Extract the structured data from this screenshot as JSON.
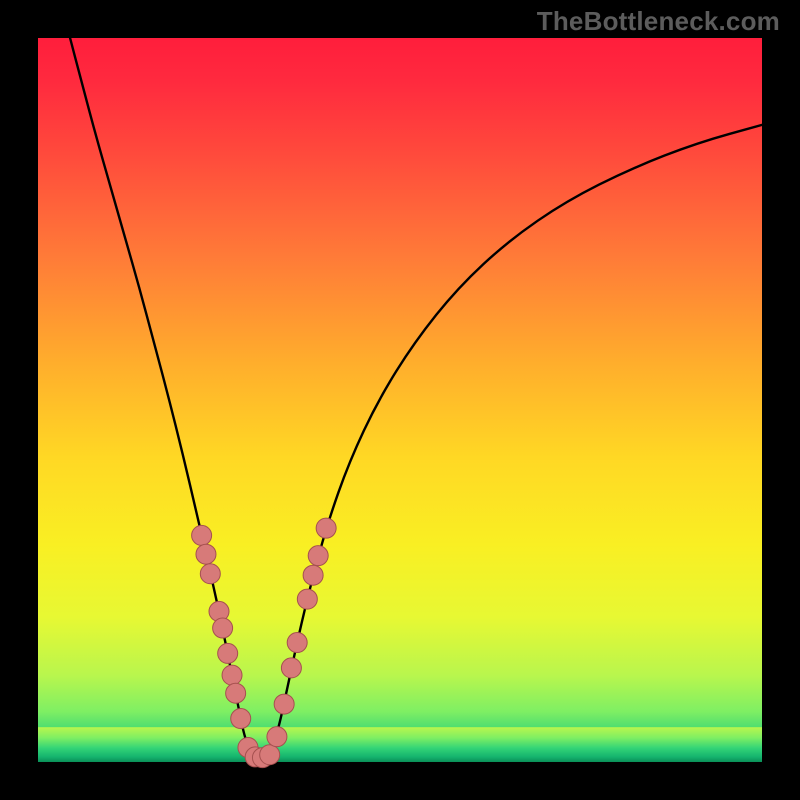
{
  "watermark": "TheBottleneck.com",
  "colors": {
    "frame": "#000000",
    "curve": "#000000",
    "dot_fill": "#d77a79",
    "dot_stroke": "#a5504f",
    "gradient_stops": [
      {
        "offset": 0.0,
        "color": "#ff1e3c"
      },
      {
        "offset": 0.06,
        "color": "#ff2a3e"
      },
      {
        "offset": 0.16,
        "color": "#ff4a3c"
      },
      {
        "offset": 0.3,
        "color": "#ff7a38"
      },
      {
        "offset": 0.45,
        "color": "#ffae2c"
      },
      {
        "offset": 0.58,
        "color": "#ffd824"
      },
      {
        "offset": 0.7,
        "color": "#f9ef23"
      },
      {
        "offset": 0.8,
        "color": "#e7f833"
      },
      {
        "offset": 0.88,
        "color": "#b9f64d"
      },
      {
        "offset": 0.93,
        "color": "#7fef63"
      },
      {
        "offset": 0.965,
        "color": "#33d477"
      },
      {
        "offset": 0.985,
        "color": "#15b46e"
      },
      {
        "offset": 1.0,
        "color": "#0a8f58"
      }
    ],
    "green_band": {
      "top": 0.952,
      "stops": [
        {
          "offset": 0.0,
          "color": "#b9f64d"
        },
        {
          "offset": 0.3,
          "color": "#7fef63"
        },
        {
          "offset": 0.6,
          "color": "#33d477"
        },
        {
          "offset": 0.85,
          "color": "#15b46e"
        },
        {
          "offset": 1.0,
          "color": "#0a8f58"
        }
      ]
    }
  },
  "chart_data": {
    "type": "line",
    "title": "",
    "xlabel": "",
    "ylabel": "",
    "x_range": [
      0,
      1
    ],
    "y_range": [
      0,
      1
    ],
    "description": "V-shaped bottleneck curve with apex near x≈0.30. Background gradient encodes bottleneck severity (red=high at top, green=low at bottom). Pink dots cluster on both arms near the bottom.",
    "series": [
      {
        "name": "bottleneck-curve",
        "points": [
          {
            "x": 0.043,
            "y": 1.005
          },
          {
            "x": 0.06,
            "y": 0.94
          },
          {
            "x": 0.08,
            "y": 0.865
          },
          {
            "x": 0.1,
            "y": 0.795
          },
          {
            "x": 0.12,
            "y": 0.725
          },
          {
            "x": 0.14,
            "y": 0.655
          },
          {
            "x": 0.16,
            "y": 0.58
          },
          {
            "x": 0.18,
            "y": 0.505
          },
          {
            "x": 0.2,
            "y": 0.425
          },
          {
            "x": 0.22,
            "y": 0.34
          },
          {
            "x": 0.235,
            "y": 0.275
          },
          {
            "x": 0.25,
            "y": 0.208
          },
          {
            "x": 0.262,
            "y": 0.15
          },
          {
            "x": 0.275,
            "y": 0.085
          },
          {
            "x": 0.285,
            "y": 0.035
          },
          {
            "x": 0.295,
            "y": 0.01
          },
          {
            "x": 0.305,
            "y": 0.005
          },
          {
            "x": 0.32,
            "y": 0.01
          },
          {
            "x": 0.332,
            "y": 0.045
          },
          {
            "x": 0.345,
            "y": 0.105
          },
          {
            "x": 0.36,
            "y": 0.175
          },
          {
            "x": 0.378,
            "y": 0.25
          },
          {
            "x": 0.4,
            "y": 0.33
          },
          {
            "x": 0.43,
            "y": 0.415
          },
          {
            "x": 0.47,
            "y": 0.5
          },
          {
            "x": 0.52,
            "y": 0.58
          },
          {
            "x": 0.58,
            "y": 0.655
          },
          {
            "x": 0.65,
            "y": 0.72
          },
          {
            "x": 0.73,
            "y": 0.775
          },
          {
            "x": 0.82,
            "y": 0.82
          },
          {
            "x": 0.91,
            "y": 0.855
          },
          {
            "x": 1.0,
            "y": 0.88
          }
        ]
      }
    ],
    "dots": [
      {
        "x": 0.226,
        "y": 0.313
      },
      {
        "x": 0.232,
        "y": 0.287
      },
      {
        "x": 0.238,
        "y": 0.26
      },
      {
        "x": 0.25,
        "y": 0.208
      },
      {
        "x": 0.255,
        "y": 0.185
      },
      {
        "x": 0.262,
        "y": 0.15
      },
      {
        "x": 0.268,
        "y": 0.12
      },
      {
        "x": 0.273,
        "y": 0.095
      },
      {
        "x": 0.28,
        "y": 0.06
      },
      {
        "x": 0.29,
        "y": 0.02
      },
      {
        "x": 0.3,
        "y": 0.007
      },
      {
        "x": 0.31,
        "y": 0.006
      },
      {
        "x": 0.32,
        "y": 0.01
      },
      {
        "x": 0.33,
        "y": 0.035
      },
      {
        "x": 0.34,
        "y": 0.08
      },
      {
        "x": 0.35,
        "y": 0.13
      },
      {
        "x": 0.358,
        "y": 0.165
      },
      {
        "x": 0.372,
        "y": 0.225
      },
      {
        "x": 0.38,
        "y": 0.258
      },
      {
        "x": 0.387,
        "y": 0.285
      },
      {
        "x": 0.398,
        "y": 0.323
      }
    ],
    "dot_radius_px": 10
  }
}
